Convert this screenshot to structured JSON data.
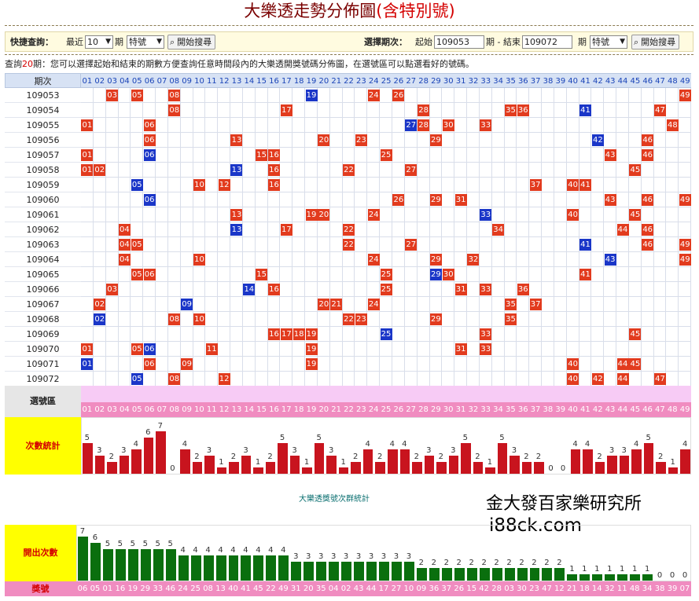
{
  "page": {
    "title_main": "大樂透走勢分佈圖",
    "title_paren_open": "(",
    "title_special": "含特別號",
    "title_paren_close": ")"
  },
  "toolbar": {
    "quick_label": "快捷查詢：",
    "recent_label": "最近",
    "recent_value": "10",
    "period_unit": "期",
    "special_option_left": "特號",
    "search_button": "開始搜尋",
    "range_label": "選擇期次：",
    "start_label": "起始",
    "start_value": "109053",
    "end_label": "期 - 結束",
    "end_value": "109072",
    "period_unit2": "期",
    "special_option_right": "特號",
    "search_button_right": "開始搜尋"
  },
  "info": {
    "prefix": "查詢",
    "count": "20",
    "suffix": "期：您可以選擇起始和結束的期數方便查詢任意時間段內的大樂透開獎號碼分佈圖，在選號區可以點選看好的號碼。"
  },
  "grid": {
    "header_label": "期次",
    "numbers": [
      "01",
      "02",
      "03",
      "04",
      "05",
      "06",
      "07",
      "08",
      "09",
      "10",
      "11",
      "12",
      "13",
      "14",
      "15",
      "16",
      "17",
      "18",
      "19",
      "20",
      "21",
      "22",
      "23",
      "24",
      "25",
      "26",
      "27",
      "28",
      "29",
      "30",
      "31",
      "32",
      "33",
      "34",
      "35",
      "36",
      "37",
      "38",
      "39",
      "40",
      "41",
      "42",
      "43",
      "44",
      "45",
      "46",
      "47",
      "48",
      "49"
    ],
    "rows": [
      {
        "period": "109053",
        "red": [
          3,
          5,
          8,
          24,
          26,
          49
        ],
        "blue": [
          19
        ]
      },
      {
        "period": "109054",
        "red": [
          8,
          17,
          28,
          35,
          36,
          47
        ],
        "blue": [
          41
        ]
      },
      {
        "period": "109055",
        "red": [
          1,
          6,
          28,
          30,
          33,
          48
        ],
        "blue": [
          27
        ]
      },
      {
        "period": "109056",
        "red": [
          6,
          13,
          20,
          23,
          29,
          46
        ],
        "blue": [
          42
        ]
      },
      {
        "period": "109057",
        "red": [
          1,
          15,
          16,
          25,
          43,
          46
        ],
        "blue": [
          6
        ]
      },
      {
        "period": "109058",
        "red": [
          1,
          2,
          16,
          22,
          27,
          45
        ],
        "blue": [
          13
        ]
      },
      {
        "period": "109059",
        "red": [
          10,
          12,
          16,
          37,
          40,
          41
        ],
        "blue": [
          5
        ]
      },
      {
        "period": "109060",
        "red": [
          26,
          29,
          31,
          43,
          46,
          49
        ],
        "blue": [
          6
        ]
      },
      {
        "period": "109061",
        "red": [
          13,
          19,
          20,
          24,
          40,
          45
        ],
        "blue": [
          33
        ]
      },
      {
        "period": "109062",
        "red": [
          4,
          17,
          22,
          34,
          44,
          46
        ],
        "blue": [
          13
        ]
      },
      {
        "period": "109063",
        "red": [
          4,
          5,
          22,
          27,
          46,
          49
        ],
        "blue": [
          41
        ]
      },
      {
        "period": "109064",
        "red": [
          4,
          10,
          24,
          29,
          32,
          49
        ],
        "blue": [
          43
        ]
      },
      {
        "period": "109065",
        "red": [
          5,
          6,
          15,
          25,
          30,
          41
        ],
        "blue": [
          29
        ]
      },
      {
        "period": "109066",
        "red": [
          3,
          16,
          25,
          31,
          33,
          36
        ],
        "blue": [
          14
        ]
      },
      {
        "period": "109067",
        "red": [
          2,
          20,
          21,
          24,
          35,
          37
        ],
        "blue": [
          9
        ]
      },
      {
        "period": "109068",
        "red": [
          8,
          10,
          22,
          23,
          29,
          35
        ],
        "blue": [
          2
        ]
      },
      {
        "period": "109069",
        "red": [
          16,
          17,
          18,
          19,
          33,
          45
        ],
        "blue": [
          25
        ]
      },
      {
        "period": "109070",
        "red": [
          1,
          5,
          11,
          19,
          31,
          33
        ],
        "blue": [
          6
        ]
      },
      {
        "period": "109071",
        "red": [
          6,
          9,
          19,
          40,
          44,
          45
        ],
        "blue": [
          1
        ]
      },
      {
        "period": "109072",
        "red": [
          8,
          12,
          40,
          42,
          44,
          47
        ],
        "blue": [
          5
        ]
      }
    ]
  },
  "select_area": {
    "label": "選號區"
  },
  "count_stats": {
    "label": "次數統計",
    "values": [
      5,
      3,
      2,
      3,
      4,
      6,
      7,
      0,
      4,
      2,
      3,
      1,
      2,
      3,
      1,
      2,
      5,
      3,
      1,
      5,
      3,
      1,
      2,
      4,
      2,
      4,
      4,
      2,
      3,
      2,
      3,
      5,
      2,
      1,
      5,
      3,
      2,
      2,
      0,
      0,
      4,
      4,
      2,
      3,
      3,
      4,
      5,
      2,
      1,
      4
    ]
  },
  "freq": {
    "section_title": "大樂透獎號次群統計",
    "label": "開出次數",
    "number_label": "獎號",
    "numbers": [
      "06",
      "05",
      "01",
      "16",
      "19",
      "29",
      "33",
      "46",
      "24",
      "25",
      "08",
      "13",
      "40",
      "41",
      "45",
      "22",
      "49",
      "31",
      "20",
      "35",
      "04",
      "02",
      "43",
      "44",
      "17",
      "27",
      "10",
      "09",
      "36",
      "37",
      "26",
      "15",
      "42",
      "28",
      "03",
      "30",
      "23",
      "47",
      "12",
      "21",
      "18",
      "14",
      "32",
      "11",
      "48",
      "34",
      "38",
      "39",
      "07"
    ],
    "values": [
      7,
      6,
      5,
      5,
      5,
      5,
      5,
      5,
      4,
      4,
      4,
      4,
      4,
      4,
      4,
      4,
      4,
      3,
      3,
      3,
      3,
      3,
      3,
      3,
      3,
      3,
      3,
      2,
      2,
      2,
      2,
      2,
      2,
      2,
      2,
      2,
      2,
      2,
      2,
      1,
      1,
      1,
      1,
      1,
      1,
      1,
      0,
      0,
      0
    ]
  },
  "brand": {
    "line1": "金大發百家樂研究所",
    "line2": "i88ck.com"
  },
  "colors": {
    "hit_red": "#e23b1e",
    "hit_blue": "#1a36c8",
    "count_bar": "#c8141e",
    "freq_bar": "#0a6f0e",
    "pink": "#f08cc0",
    "label_yellow": "#ffff00"
  }
}
